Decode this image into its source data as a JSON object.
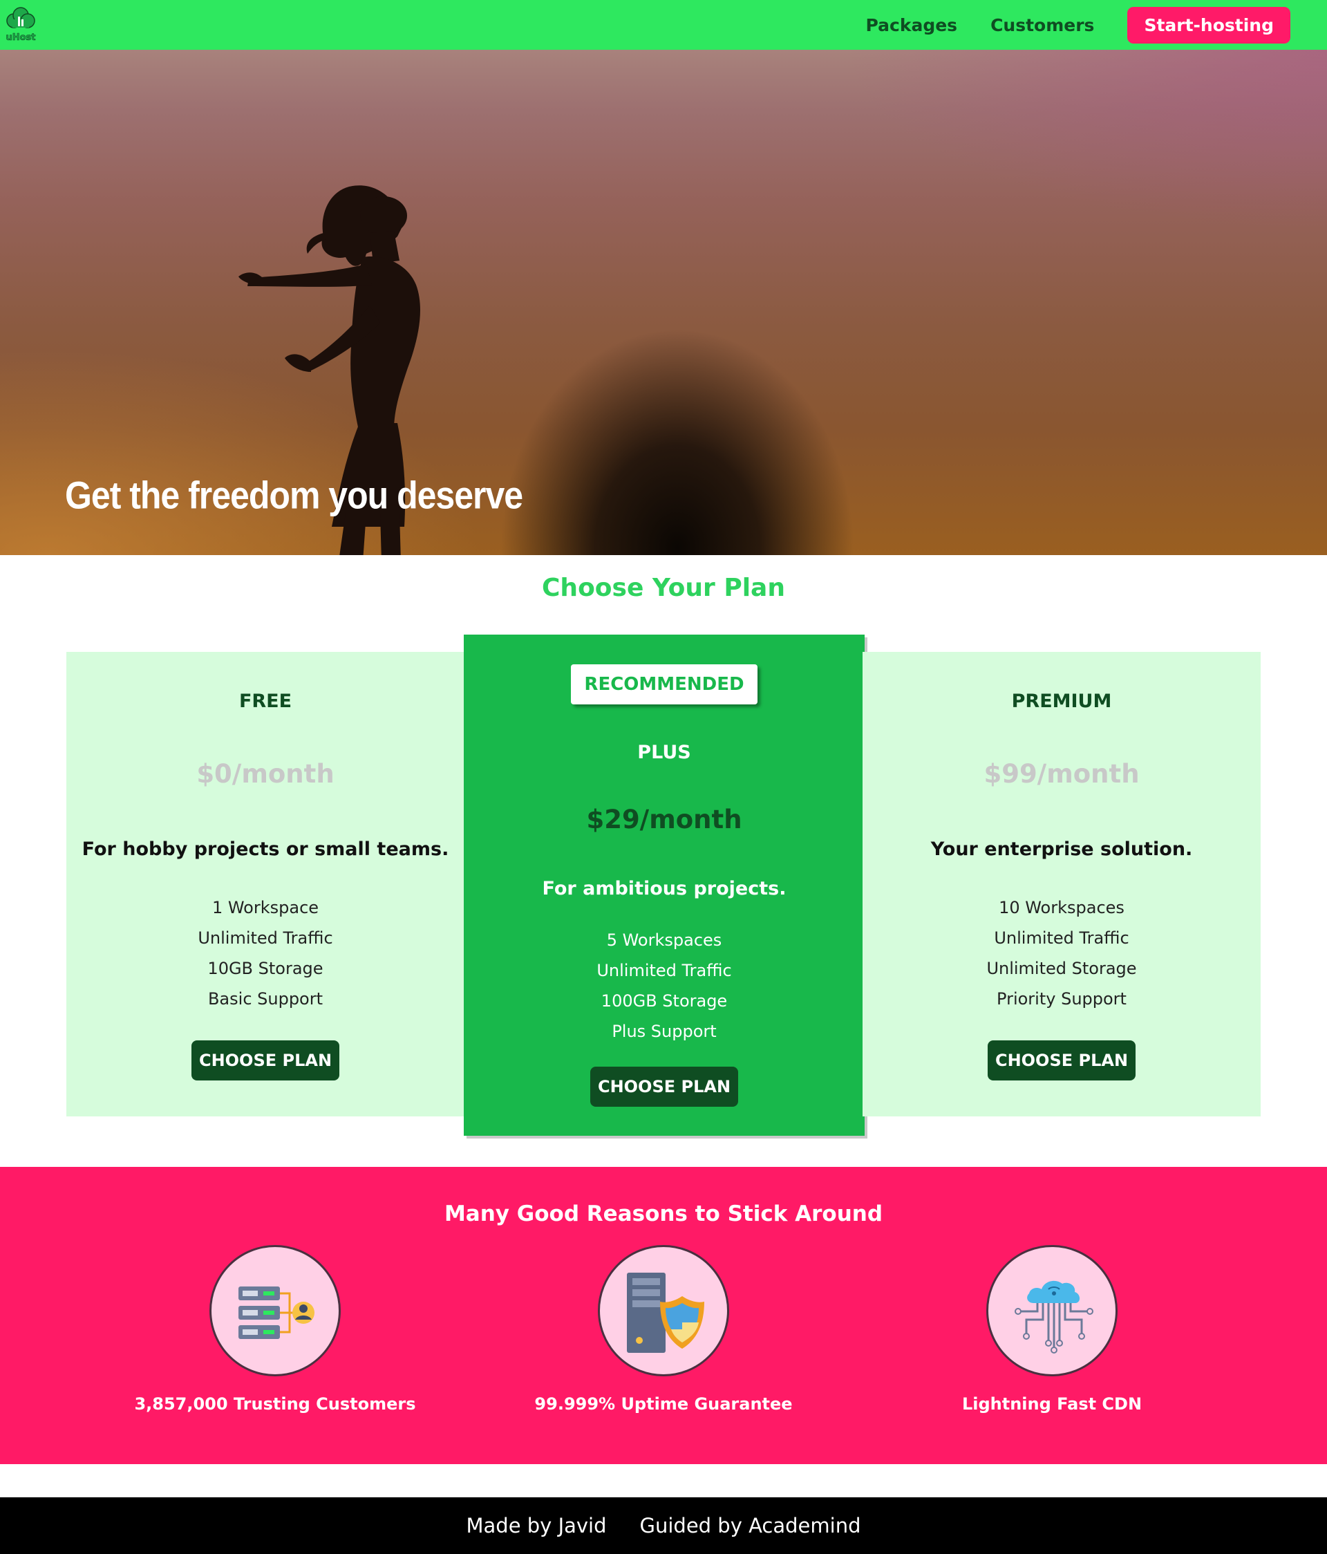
{
  "nav": {
    "logo_text": "uHost",
    "links": [
      "Packages",
      "Customers"
    ],
    "cta": "Start-hosting"
  },
  "hero": {
    "title": "Get the freedom you deserve"
  },
  "plans": {
    "title": "Choose Your Plan",
    "items": [
      {
        "name": "FREE",
        "price": "$0/month",
        "description": "For hobby projects or small teams.",
        "features": [
          "1 Workspace",
          "Unlimited Traffic",
          "10GB Storage",
          "Basic Support"
        ],
        "button": "CHOOSE PLAN"
      },
      {
        "badge": "RECOMMENDED",
        "name": "PLUS",
        "price": "$29/month",
        "description": "For ambitious projects.",
        "features": [
          "5 Workspaces",
          "Unlimited Traffic",
          "100GB Storage",
          "Plus Support"
        ],
        "button": "CHOOSE PLAN"
      },
      {
        "name": "PREMIUM",
        "price": "$99/month",
        "description": "Your enterprise solution.",
        "features": [
          "10 Workspaces",
          "Unlimited Traffic",
          "Unlimited Storage",
          "Priority Support"
        ],
        "button": "CHOOSE PLAN"
      }
    ]
  },
  "reasons": {
    "title": "Many Good Reasons to Stick Around",
    "items": [
      {
        "label": "3,857,000 Trusting Customers",
        "icon": "server-customers-icon"
      },
      {
        "label": "99.999% Uptime Guarantee",
        "icon": "server-shield-icon"
      },
      {
        "label": "Lightning Fast CDN",
        "icon": "cloud-network-icon"
      }
    ]
  },
  "footer": {
    "links": [
      "Made by Javid",
      "Guided by Academind"
    ]
  },
  "colors": {
    "nav": "#2ee85f",
    "accent_pink": "#ff1a68",
    "plan_side_bg": "#d6fcdc",
    "plan_plus_bg": "#18b84b",
    "dark_green": "#0f4d22"
  }
}
